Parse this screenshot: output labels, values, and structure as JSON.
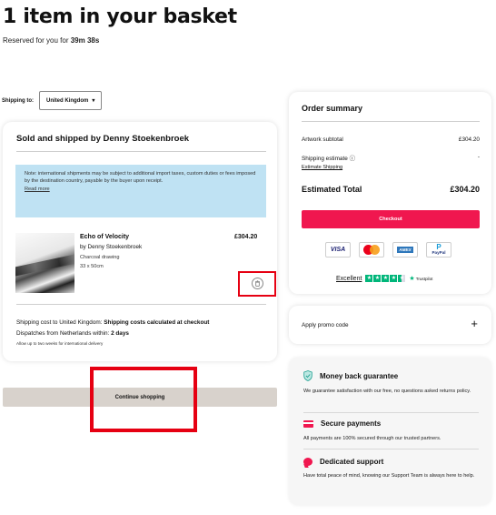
{
  "header": {
    "title": "1 item in your basket",
    "reserved_prefix": "Reserved for you for ",
    "reserved_time": "39m 38s"
  },
  "shipping": {
    "label": "Shipping to:",
    "country": "United Kingdom"
  },
  "seller": {
    "title": "Sold and shipped by Denny Stoekenbroek",
    "notice": "Note: international shipments may be subject to additional import taxes, custom duties or fees imposed by the destination country, payable by the buyer upon receipt.",
    "notice_link": "Read more"
  },
  "item": {
    "name": "Echo of Velocity",
    "artist": "by Denny Stoekenbroek",
    "medium": "Charcoal drawing",
    "size": "33 x 50cm",
    "price": "£304.20"
  },
  "shipping_info": {
    "cost_prefix": "Shipping cost to United Kingdom: ",
    "cost_value": "Shipping costs calculated at checkout",
    "dispatch_prefix": "Dispatches from Netherlands within: ",
    "dispatch_value": "2 days",
    "delivery_note": "Allow up to two weeks for international delivery"
  },
  "continue_button": "Continue shopping",
  "summary": {
    "title": "Order summary",
    "subtotal_label": "Artwork subtotal",
    "subtotal_value": "£304.20",
    "shipping_label": "Shipping estimate",
    "shipping_value": "-",
    "estimate_link": "Estimate Shipping",
    "total_label": "Estimated Total",
    "total_value": "£304.20",
    "checkout": "Checkout",
    "payments": [
      "VISA",
      "mastercard",
      "AMEX",
      "PayPal"
    ],
    "trust_label": "Excellent",
    "trust_brand": "Trustpilot",
    "trust_rating": 4.5
  },
  "promo": {
    "label": "Apply promo code",
    "plus": "+"
  },
  "benefits": [
    {
      "title": "Money back guarantee",
      "text": "We guarantee satisfaction with our free, no questions asked returns policy."
    },
    {
      "title": "Secure payments",
      "text": "All payments are 100% secured through our trusted partners."
    },
    {
      "title": "Dedicated support",
      "text": "Have total peace of mind, knowing our Support Team is always here to help."
    }
  ],
  "colors": {
    "accent": "#f0174f",
    "notice_bg": "#bfe2f3",
    "highlight_box": "#e60012",
    "trustpilot": "#00b67a"
  }
}
